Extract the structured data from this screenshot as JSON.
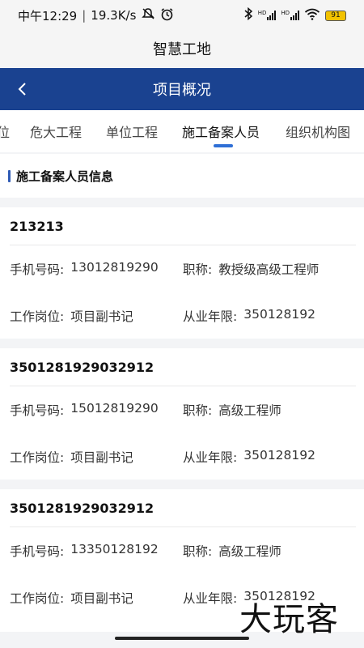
{
  "status_bar": {
    "time": "中午12:29",
    "network_speed": "19.3K/s",
    "battery": "91",
    "icons": [
      "mute-icon",
      "alarm-icon",
      "bluetooth-icon",
      "hd-signal-icon",
      "hd-signal-icon",
      "wifi-icon",
      "battery-icon"
    ]
  },
  "app": {
    "title": "智慧工地"
  },
  "nav": {
    "title": "项目概况",
    "back_icon": "chevron-left-icon"
  },
  "tabs": [
    {
      "label": "位",
      "active": false
    },
    {
      "label": "危大工程",
      "active": false
    },
    {
      "label": "单位工程",
      "active": false
    },
    {
      "label": "施工备案人员",
      "active": true
    },
    {
      "label": "组织机构图",
      "active": false
    }
  ],
  "section": {
    "title": "施工备案人员信息"
  },
  "labels": {
    "phone": "手机号码:",
    "title": "职称:",
    "position": "工作岗位:",
    "years": "从业年限:"
  },
  "personnel": [
    {
      "name": "213213",
      "phone": "13012819290",
      "title": "教授级高级工程师",
      "position": "项目副书记",
      "years": "350128192"
    },
    {
      "name": "3501281929032912",
      "phone": "15012819290",
      "title": "高级工程师",
      "position": "项目副书记",
      "years": "350128192"
    },
    {
      "name": "3501281929032912",
      "phone": "13350128192",
      "title": "高级工程师",
      "position": "项目副书记",
      "years": "350128192"
    }
  ],
  "watermark": "大玩客",
  "colors": {
    "nav_bg": "#1a4290",
    "accent": "#2f6fd6",
    "page_bg": "#f3f4f6"
  }
}
